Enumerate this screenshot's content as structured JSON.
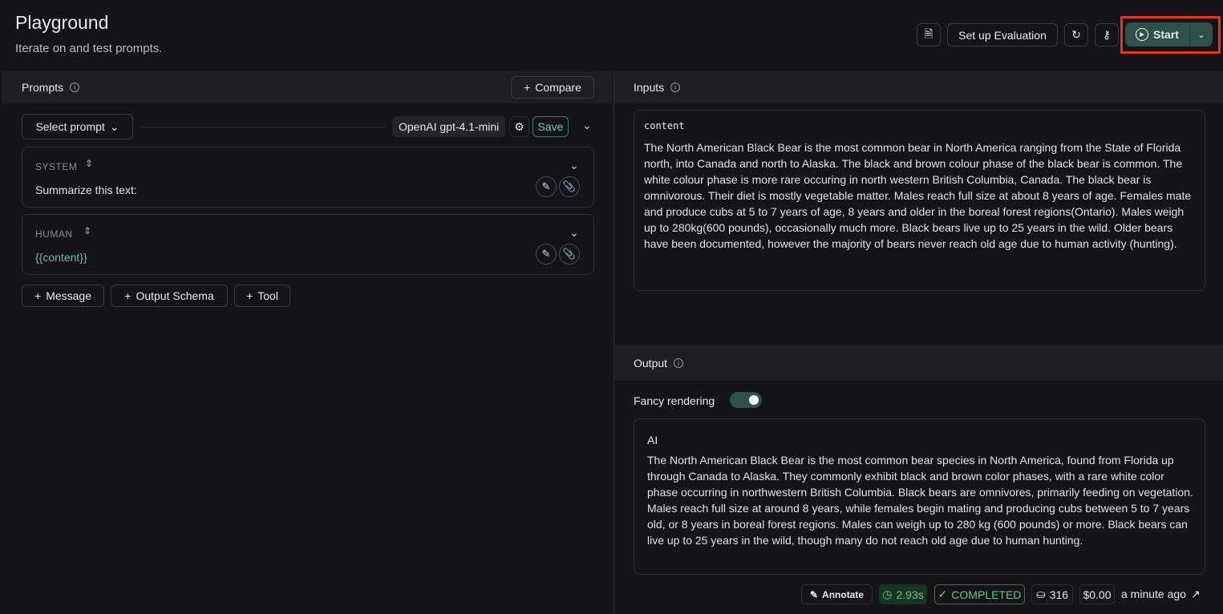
{
  "header": {
    "title": "Playground",
    "subtitle": "Iterate on and test prompts.",
    "setup_eval": "Set up Evaluation",
    "start": "Start"
  },
  "prompts": {
    "title": "Prompts",
    "compare": "Compare",
    "select_prompt": "Select prompt",
    "model": "OpenAI gpt-4.1-mini",
    "save": "Save",
    "messages": [
      {
        "role": "SYSTEM",
        "text": "Summarize this text:"
      },
      {
        "role": "HUMAN",
        "text": "{{content}}"
      }
    ],
    "add_message": "Message",
    "add_schema": "Output Schema",
    "add_tool": "Tool"
  },
  "inputs": {
    "title": "Inputs",
    "key": "content",
    "value": "The North American Black Bear is the most common bear in North America ranging from the State of Florida north, into Canada and north to Alaska. The black and brown colour phase of the black bear is common. The white colour phase is more rare occuring in north western British Columbia, Canada. The black bear is omnivorous. Their diet is mostly vegetable matter. Males reach full size at about 8 years of age. Females mate and produce cubs at 5 to 7 years of age, 8 years and older in the boreal forest regions(Ontario). Males weigh up to 280kg(600 pounds), occasionally much more. Black bears live up to 25 years in the wild. Older bears have been documented, however the majority of bears never reach old age due to human activity (hunting)."
  },
  "output": {
    "title": "Output",
    "fancy_label": "Fancy rendering",
    "fancy_on": true,
    "role": "AI",
    "text": "The North American Black Bear is the most common bear species in North America, found from Florida up through Canada to Alaska. They commonly exhibit black and brown color phases, with a rare white color phase occurring in northwestern British Columbia. Black bears are omnivores, primarily feeding on vegetation. Males reach full size at around 8 years, while females begin mating and producing cubs between 5 to 7 years old, or 8 years in boreal forest regions. Males can weigh up to 280 kg (600 pounds) or more. Black bears can live up to 25 years in the wild, though many do not reach old age due to human hunting.",
    "annotate": "Annotate",
    "latency": "2.93s",
    "status": "COMPLETED",
    "tokens": "316",
    "cost": "$0.00",
    "time": "a minute ago"
  },
  "colors": {
    "accent": "#2e4f4a",
    "green": "#5fc98a",
    "highlight": "#e8321e"
  }
}
